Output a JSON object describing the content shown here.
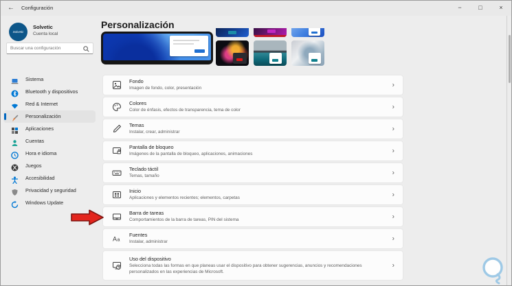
{
  "titlebar": {
    "back_icon": "←",
    "title": "Configuración",
    "minimize_icon": "−",
    "maximize_icon": "□",
    "close_icon": "×"
  },
  "user": {
    "name": "Solvetic",
    "account_type": "Cuenta local",
    "avatar_text": "Solvetic"
  },
  "search": {
    "placeholder": "Buscar una configuración"
  },
  "sidebar": {
    "items": [
      {
        "label": "Sistema",
        "icon": "laptop-icon",
        "selected": false
      },
      {
        "label": "Bluetooth y dispositivos",
        "icon": "bluetooth-icon",
        "selected": false
      },
      {
        "label": "Red & Internet",
        "icon": "wifi-icon",
        "selected": false
      },
      {
        "label": "Personalización",
        "icon": "paintbrush-icon",
        "selected": true
      },
      {
        "label": "Aplicaciones",
        "icon": "apps-grid-icon",
        "selected": false
      },
      {
        "label": "Cuentas",
        "icon": "person-icon",
        "selected": false
      },
      {
        "label": "Hora e idioma",
        "icon": "clock-icon",
        "selected": false
      },
      {
        "label": "Juegos",
        "icon": "xbox-icon",
        "selected": false
      },
      {
        "label": "Accesibilidad",
        "icon": "accessibility-icon",
        "selected": false
      },
      {
        "label": "Privacidad y seguridad",
        "icon": "shield-icon",
        "selected": false
      },
      {
        "label": "Windows Update",
        "icon": "update-arrows-icon",
        "selected": false
      }
    ]
  },
  "page": {
    "title": "Personalización"
  },
  "theme_thumbnails": [
    {
      "name": "dark-blue-theme",
      "accent": "#1a8ca8"
    },
    {
      "name": "purple-glow-theme",
      "accent": "#c225c2"
    },
    {
      "name": "light-blue-theme",
      "accent": "#1f6fd0"
    },
    {
      "name": "dark-flower-theme",
      "accent": "#e01515"
    },
    {
      "name": "teal-bridge-theme",
      "accent": "#0e7f8c"
    },
    {
      "name": "gray-abstract-theme",
      "accent": "#0e7f8c"
    }
  ],
  "settings": [
    {
      "title": "Fondo",
      "subtitle": "Imagen de fondo, color, presentación",
      "icon": "image-icon"
    },
    {
      "title": "Colores",
      "subtitle": "Color de énfasis, efectos de transparencia, tema de color",
      "icon": "palette-icon"
    },
    {
      "title": "Temas",
      "subtitle": "Instalar, crear, administrar",
      "icon": "pen-icon"
    },
    {
      "title": "Pantalla de bloqueo",
      "subtitle": "Imágenes de la pantalla de bloqueo, aplicaciones, animaciones",
      "icon": "lock-screen-icon"
    },
    {
      "title": "Teclado táctil",
      "subtitle": "Temas, tamaño",
      "icon": "keyboard-icon"
    },
    {
      "title": "Inicio",
      "subtitle": "Aplicaciones y elementos recientes; elementos, carpetas",
      "icon": "start-icon"
    },
    {
      "title": "Barra de tareas",
      "subtitle": "Comportamientos de la barra de tareas, PIN del sistema",
      "icon": "taskbar-icon"
    },
    {
      "title": "Fuentes",
      "subtitle": "Instalar, administrar",
      "icon": "fonts-icon"
    },
    {
      "title": "Uso del dispositivo",
      "subtitle": "Selecciona todas las formas en que planeas usar el dispositivo para obtener sugerencias, anuncios y recomendaciones personalizados en las experiencias de Microsoft.",
      "icon": "device-usage-icon"
    }
  ],
  "ui": {
    "chevron_icon": "›"
  },
  "annotation": {
    "type": "red-arrow",
    "points_to": "Barra de tareas",
    "color": "#e3251d"
  },
  "colors": {
    "accent": "#0067c0",
    "window_bg": "#ededed",
    "card_bg": "#fcfcfc",
    "arrow_red": "#e3251d"
  }
}
